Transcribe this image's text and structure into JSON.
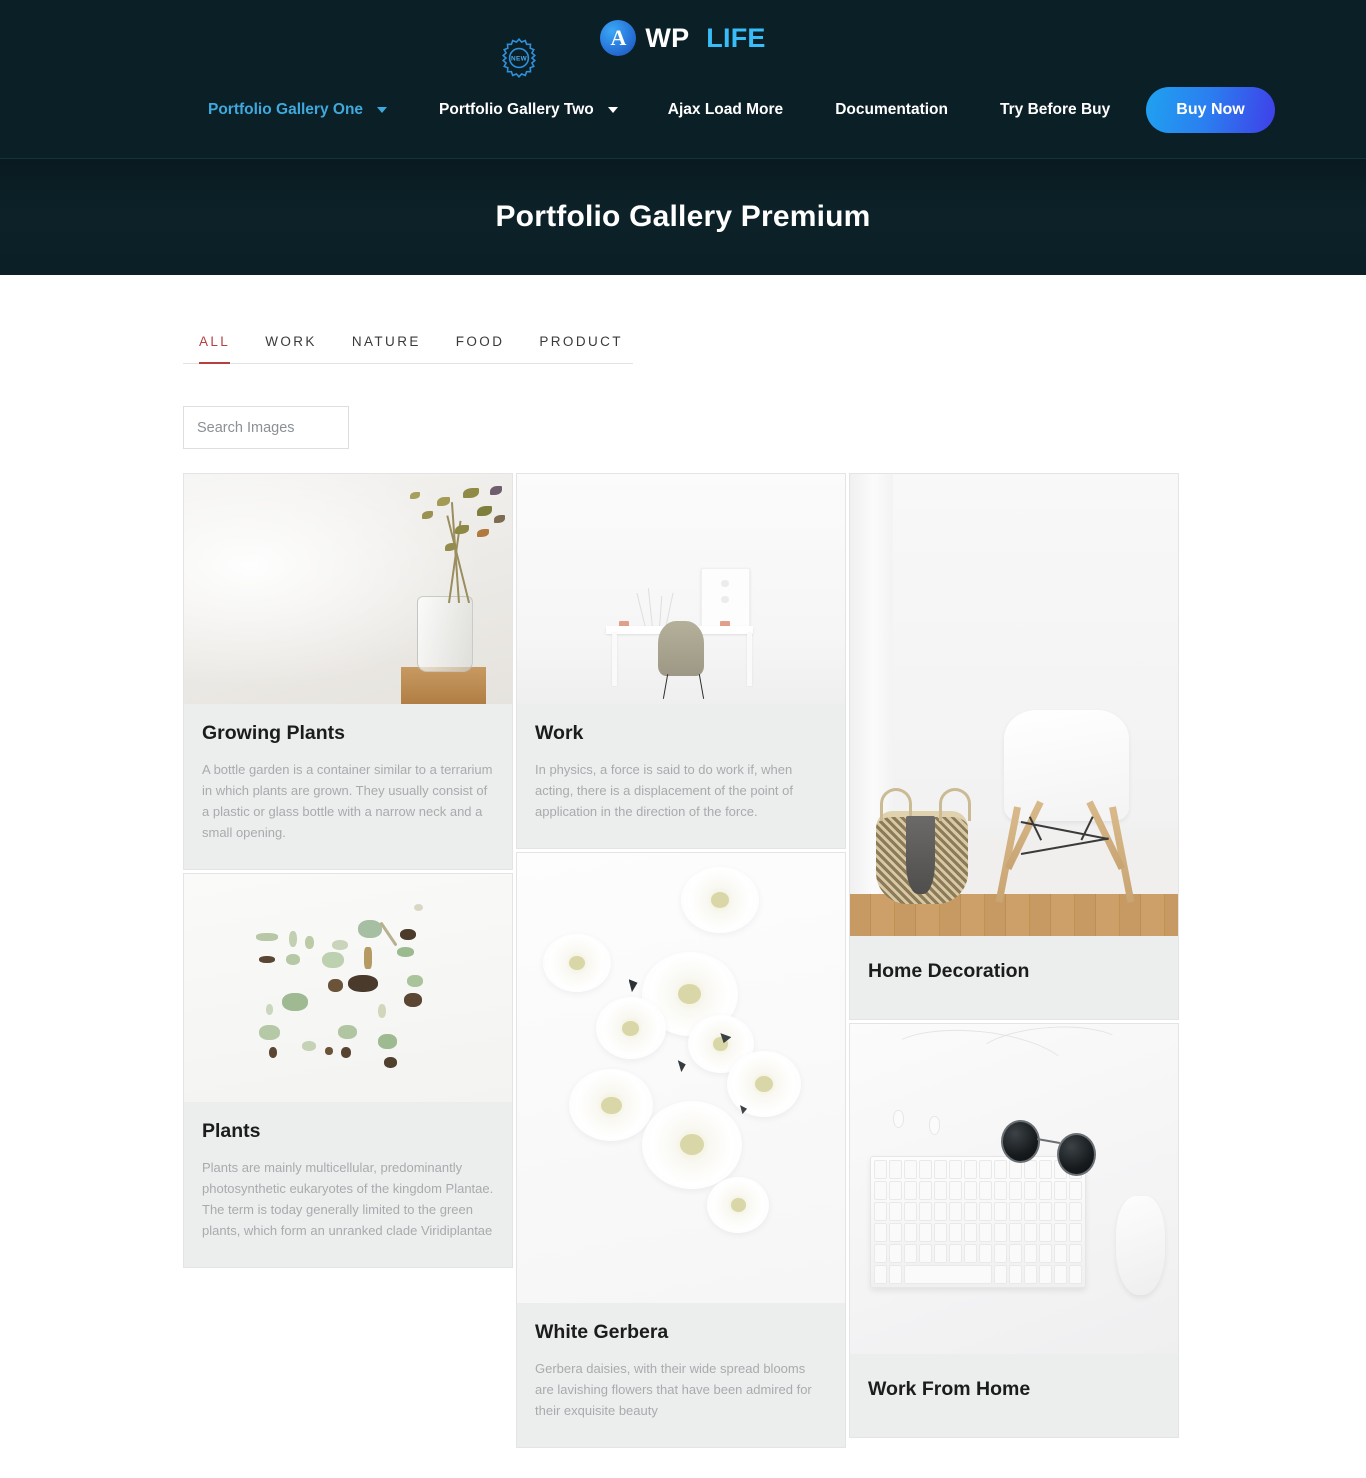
{
  "header": {
    "logo": {
      "mark": "A",
      "wp": "WP",
      "life": "LIFE"
    },
    "nav": [
      {
        "label": "Portfolio Gallery One",
        "has_caret": true,
        "active": true,
        "badge": null
      },
      {
        "label": "Portfolio Gallery Two",
        "has_caret": true,
        "active": false,
        "badge": null
      },
      {
        "label": "Ajax Load More",
        "has_caret": false,
        "active": false,
        "badge": "NEW"
      },
      {
        "label": "Documentation",
        "has_caret": false,
        "active": false,
        "badge": null
      },
      {
        "label": "Try Before Buy",
        "has_caret": false,
        "active": false,
        "badge": null
      }
    ],
    "buy_button": "Buy Now"
  },
  "banner": {
    "title": "Portfolio Gallery Premium"
  },
  "filters": [
    {
      "label": "ALL",
      "active": true
    },
    {
      "label": "WORK",
      "active": false
    },
    {
      "label": "NATURE",
      "active": false
    },
    {
      "label": "FOOD",
      "active": false
    },
    {
      "label": "PRODUCT",
      "active": false
    }
  ],
  "search": {
    "value": "",
    "placeholder": "Search Images"
  },
  "gallery": {
    "items": [
      {
        "title": "Growing Plants",
        "description": "A bottle garden is a container similar to a terrarium in which plants are grown. They usually consist of a plastic or glass bottle with a narrow neck and a small opening.",
        "image_alt": "dried-flowers-in-glass-vase-on-wooden-shelf"
      },
      {
        "title": "Work",
        "description": "In physics, a force is said to do work if, when acting, there is a displacement of the point of application in the direction of the force.",
        "image_alt": "minimal-white-desk-with-olive-chair"
      },
      {
        "title": "Home Decoration",
        "description": "",
        "image_alt": "woven-basket-with-grey-towel-and-white-eames-chair"
      },
      {
        "title": "Plants",
        "description": "Plants are mainly multicellular, predominantly photosynthetic eukaryotes of the kingdom Plantae. The term is today generally limited to the green plants, which form an unranked clade Viridiplantae",
        "image_alt": "succulent-cuttings-arranged-on-white-background"
      },
      {
        "title": "White Gerbera",
        "description": "Gerbera daisies, with their wide spread blooms are lavishing flowers that have been admired for their exquisite beauty",
        "image_alt": "white-chrysanthemum-blooms-on-white-background"
      },
      {
        "title": "Work From Home",
        "description": "",
        "image_alt": "white-keyboard-mouse-sunglasses-earphones-flatlay"
      }
    ]
  },
  "colors": {
    "header_bg": "#0b1f26",
    "accent_blue": "#38bdf8",
    "active_filter": "#b5403f",
    "card_bg": "#eceded"
  }
}
